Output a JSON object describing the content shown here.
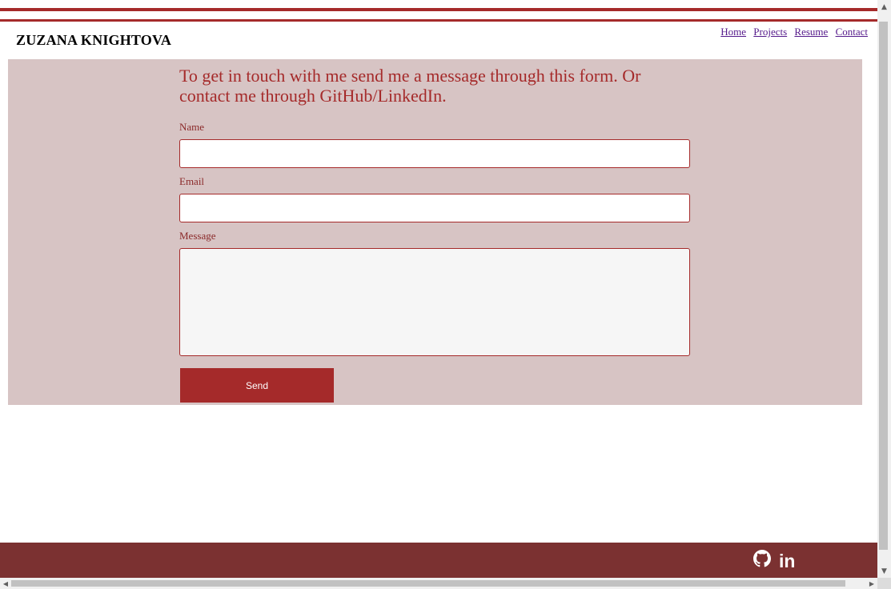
{
  "site": {
    "brand": "ZUZANA KNIGHTOVA"
  },
  "nav": {
    "items": [
      "Home",
      "Projects",
      "Resume",
      "Contact"
    ]
  },
  "contact": {
    "intro": "To get in touch with me send me a message through this form. Or contact me through GitHub/LinkedIn.",
    "name_label": "Name",
    "email_label": "Email",
    "message_label": "Message",
    "send_label": "Send"
  },
  "footer": {
    "icons": [
      "github-icon",
      "linkedin-icon"
    ],
    "linkedin_glyph": "in"
  },
  "colors": {
    "accent": "#a52a2a",
    "panel_bg": "#d7c4c4",
    "footer_bg": "#7b3131"
  }
}
